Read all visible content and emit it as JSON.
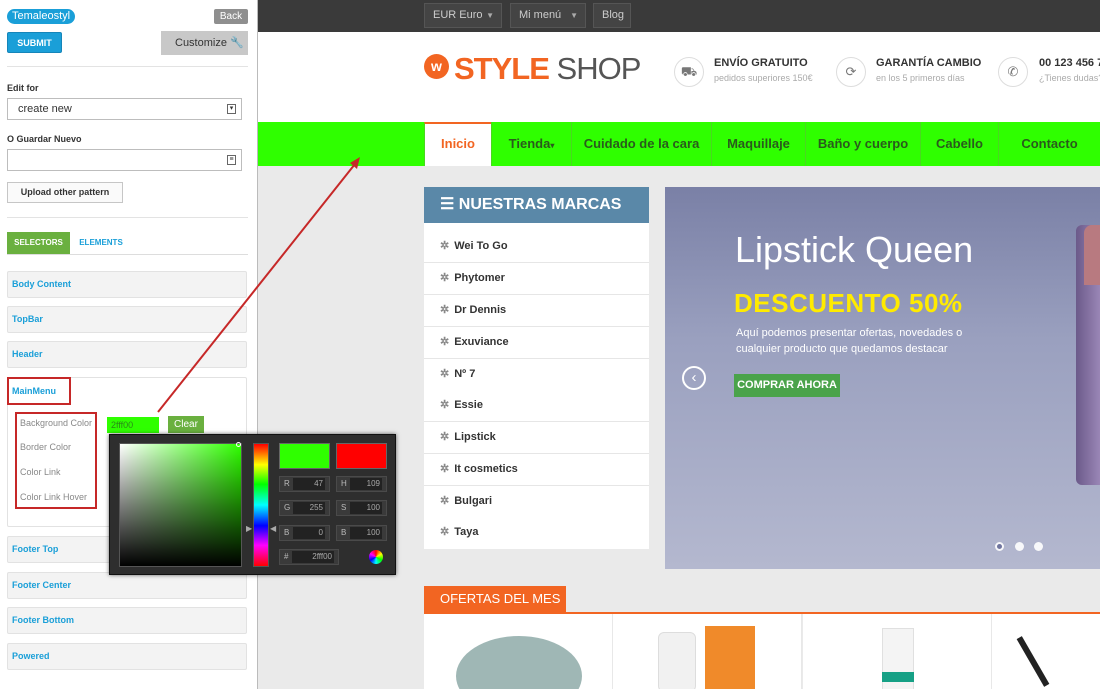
{
  "panel": {
    "theme_name": "Temaleostyl",
    "back_label": "Back",
    "submit_label": "SUBMIT",
    "customize_label": "Customize",
    "edit_for_label": "Edit for",
    "edit_for_value": "create new",
    "save_new_label": "O Guardar Nuevo",
    "save_new_value": "",
    "upload_label": "Upload other pattern",
    "tabs": [
      "SELECTORS",
      "ELEMENTS"
    ],
    "sections": [
      "Body Content",
      "TopBar",
      "Header",
      "MainMenu",
      "Footer Top",
      "Footer Center",
      "Footer Bottom",
      "Powered"
    ],
    "mainmenu_items": [
      "Background Color",
      "Border Color",
      "Color Link",
      "Color Link Hover"
    ],
    "color_value": "2fff00",
    "clear_label": "Clear"
  },
  "picker": {
    "r_label": "R",
    "r_value": "47",
    "g_label": "G",
    "g_value": "255",
    "b_label": "B",
    "b_value": "0",
    "h_label": "H",
    "h_value": "109",
    "s_label": "S",
    "s_value": "100",
    "b2_label": "B",
    "b2_value": "100",
    "hex_label": "#",
    "hex_value": "2fff00",
    "new_color": "#2fff00",
    "current_color": "#ff0000"
  },
  "site": {
    "topbar": [
      "EUR Euro",
      "Mi menú",
      "Blog"
    ],
    "logo_mark": "w",
    "logo_style": "STYLE",
    "logo_shop": "SHOP",
    "header_info": [
      {
        "icon": "truck-icon",
        "title": "ENVÍO GRATUITO",
        "sub": "pedidos superiores 150€"
      },
      {
        "icon": "refresh-icon",
        "title": "GARANTÍA CAMBIO",
        "sub": "en los 5 primeros días"
      },
      {
        "icon": "phone-icon",
        "title": "00 123 456 7",
        "sub": "¿Tienes dudas?"
      }
    ],
    "menu": [
      "Inicio",
      "Tienda",
      "Cuidado de la cara",
      "Maquillaje",
      "Baño y cuerpo",
      "Cabello",
      "Contacto"
    ],
    "brands_title": "NUESTRAS MARCAS",
    "brands": [
      "Wei To Go",
      "Phytomer",
      "Dr Dennis",
      "Exuviance",
      "Nº 7",
      "Essie",
      "Lipstick",
      "It cosmetics",
      "Bulgari",
      "Taya"
    ],
    "slide": {
      "title": "Lipstick Queen",
      "discount": "DESCUENTO 50%",
      "desc": "Aquí podemos presentar ofertas, novedades o cualquier producto que quedamos destacar",
      "button": "COMPRAR AHORA"
    },
    "ofertas": "OFERTAS DEL MES"
  },
  "colors": {
    "accent": "#1a9fd8",
    "green": "#6ab03f",
    "menu_bg": "#2fff00",
    "orange": "#f26522",
    "highlight": "#c62828"
  }
}
